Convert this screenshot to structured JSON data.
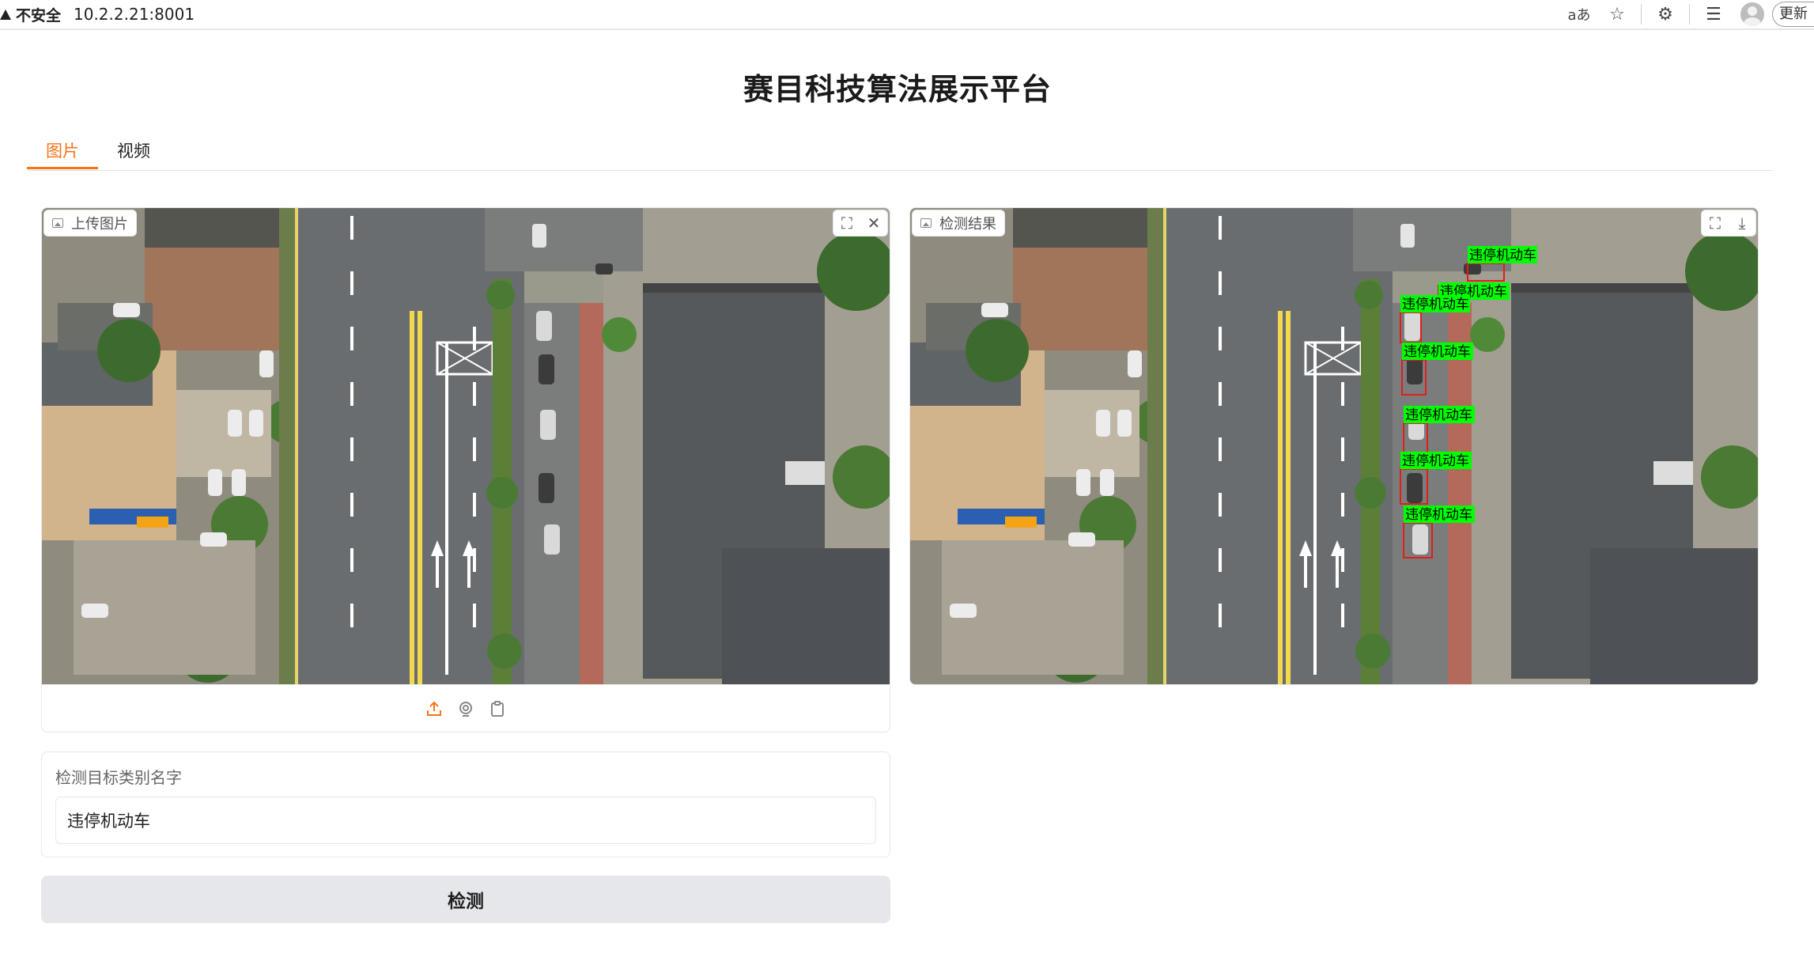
{
  "browser": {
    "security_label": "不安全",
    "url": "10.2.2.21:8001",
    "update_label": "更新"
  },
  "page": {
    "title": "赛目科技算法展示平台"
  },
  "tabs": [
    {
      "label": "图片",
      "active": true
    },
    {
      "label": "视频",
      "active": false
    }
  ],
  "upload_panel": {
    "label": "上传图片"
  },
  "result_panel": {
    "label": "检测结果",
    "detections": [
      {
        "label": "违停机动车"
      },
      {
        "label": "违停机动车"
      },
      {
        "label": "违停机动车"
      },
      {
        "label": "违停机动车"
      },
      {
        "label": "违停机动车"
      },
      {
        "label": "违停机动车"
      },
      {
        "label": "违停机动车"
      }
    ]
  },
  "target_input": {
    "label": "检测目标类别名字",
    "value": "违停机动车"
  },
  "detect_button": {
    "label": "检测"
  },
  "colors": {
    "accent": "#f97316",
    "detection_label_bg": "#00ff00",
    "detection_box": "#e11d1d",
    "button_bg": "#e5e7eb"
  }
}
